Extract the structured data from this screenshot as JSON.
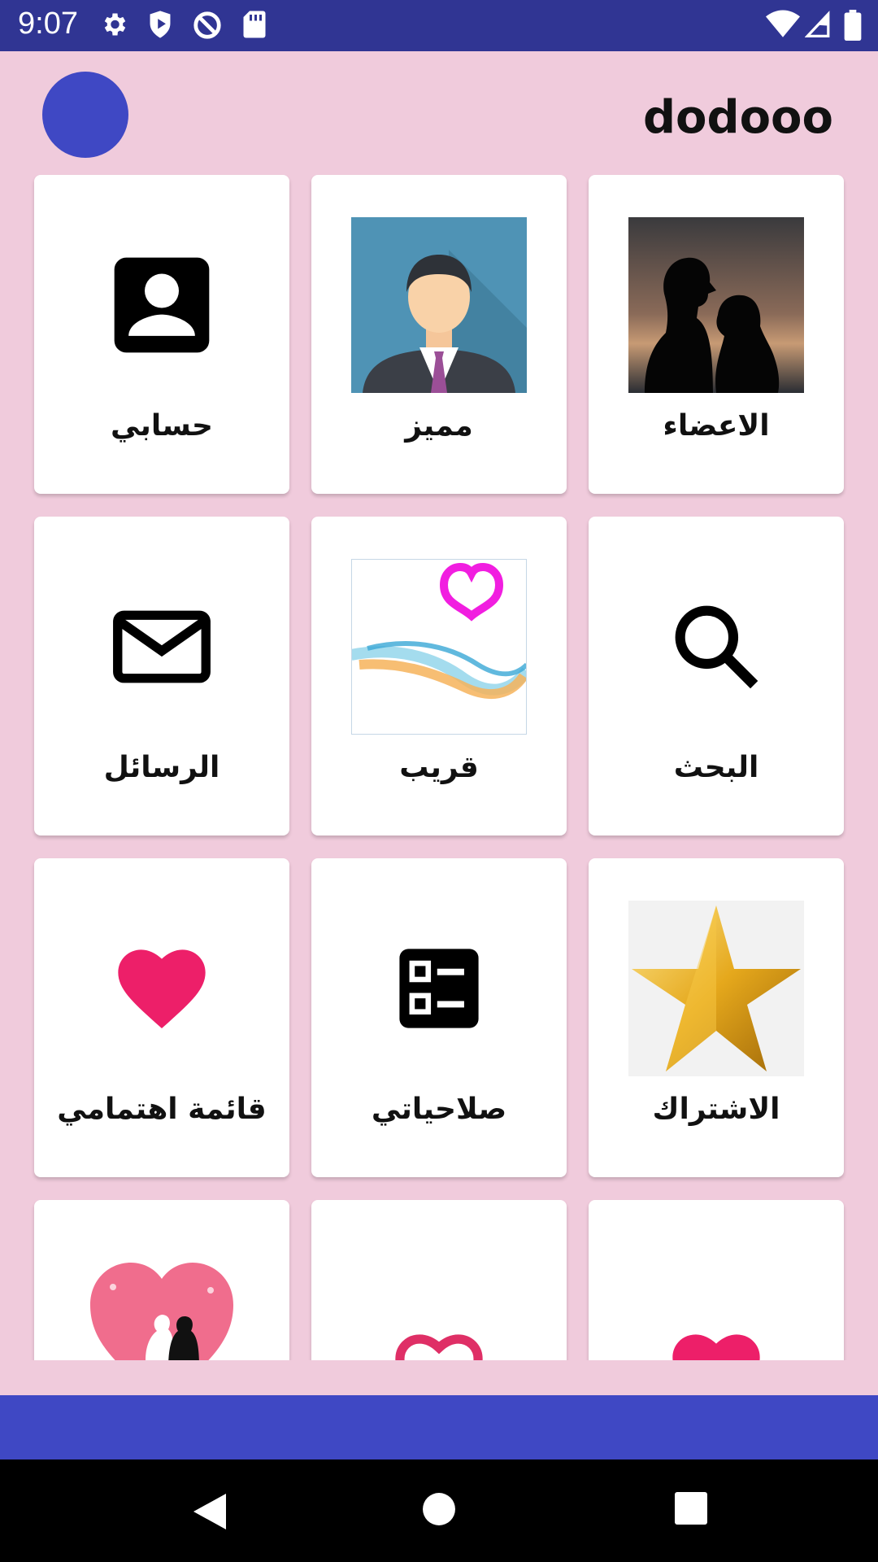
{
  "status_bar": {
    "time": "9:07",
    "icons": [
      "gear-icon",
      "shield-play-icon",
      "no-sync-icon",
      "sd-card-icon",
      "wifi-icon",
      "signal-icon",
      "battery-icon"
    ]
  },
  "app": {
    "title": "dodooo",
    "accent": "#3f48c4",
    "background": "#f0cbdc"
  },
  "grid": {
    "rows": [
      [
        {
          "label": "حسابي",
          "icon": "account-box-icon"
        },
        {
          "label": "مميز",
          "icon": "businessman-avatar-image"
        },
        {
          "label": "الاعضاء",
          "icon": "couple-silhouette-image"
        }
      ],
      [
        {
          "label": "الرسائل",
          "icon": "mail-icon"
        },
        {
          "label": "قريب",
          "icon": "heart-wave-image"
        },
        {
          "label": "البحث",
          "icon": "search-icon"
        }
      ],
      [
        {
          "label": "قائمة اهتمامي",
          "icon": "heart-filled-icon"
        },
        {
          "label": "صلاحياتي",
          "icon": "checklist-icon"
        },
        {
          "label": "الاشتراك",
          "icon": "gold-star-image"
        }
      ],
      [
        {
          "label": "",
          "icon": "wedding-couple-heart-image"
        },
        {
          "label": "",
          "icon": "heart-outline-icon"
        },
        {
          "label": "",
          "icon": "heart-filled-icon"
        }
      ]
    ]
  },
  "nav": {
    "icons": [
      "back-icon",
      "home-icon",
      "recents-icon"
    ]
  }
}
